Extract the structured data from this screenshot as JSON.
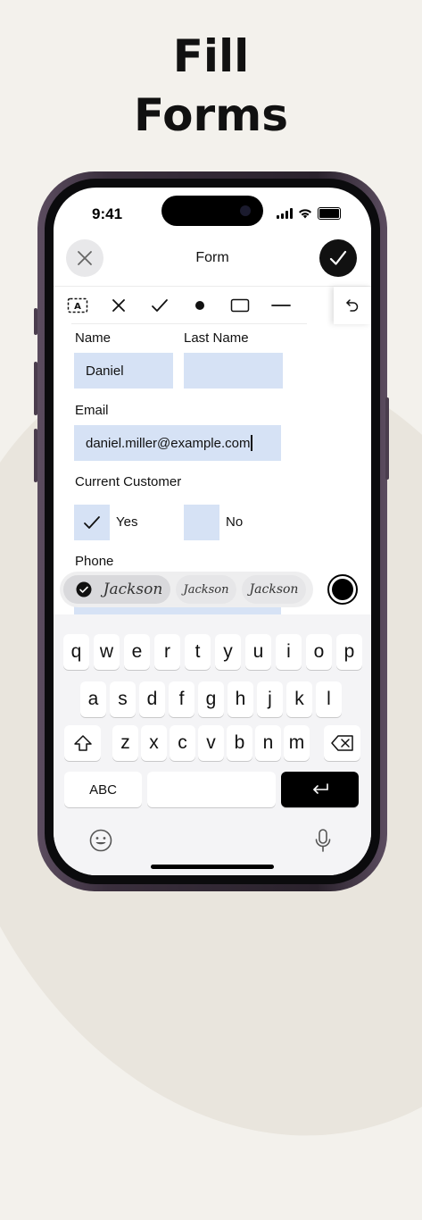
{
  "headline": {
    "line1": "Fill",
    "line2": "Forms"
  },
  "status_bar": {
    "time": "9:41"
  },
  "nav": {
    "title": "Form"
  },
  "form": {
    "name_label": "Name",
    "name_value": "Daniel",
    "last_name_label": "Last Name",
    "last_name_value": "",
    "email_label": "Email",
    "email_value": "daniel.miller@example.com",
    "customer_label": "Current Customer",
    "yes_label": "Yes",
    "no_label": "No",
    "yes_checked": true,
    "no_checked": false,
    "phone_label": "Phone"
  },
  "signatures": [
    {
      "text": "Jackson",
      "selected": true
    },
    {
      "text": "Jackson",
      "selected": false
    },
    {
      "text": "Jackson",
      "selected": false
    }
  ],
  "pen_color": "#000000",
  "keyboard": {
    "row1": [
      "q",
      "w",
      "e",
      "r",
      "t",
      "y",
      "u",
      "i",
      "o",
      "p"
    ],
    "row2": [
      "a",
      "s",
      "d",
      "f",
      "g",
      "h",
      "j",
      "k",
      "l"
    ],
    "row3": [
      "z",
      "x",
      "c",
      "v",
      "b",
      "n",
      "m"
    ],
    "abc_label": "ABC"
  },
  "icons": {
    "close": "close-icon",
    "done": "checkmark-icon",
    "tools": [
      "text-box-icon",
      "cross-mark-icon",
      "checkmark-icon",
      "dot-icon",
      "rectangle-icon",
      "line-icon"
    ],
    "undo": "undo-icon",
    "emoji": "emoji-icon",
    "mic": "microphone-icon"
  },
  "colors": {
    "field_bg": "#d6e2f5",
    "accent_dark": "#111111"
  }
}
